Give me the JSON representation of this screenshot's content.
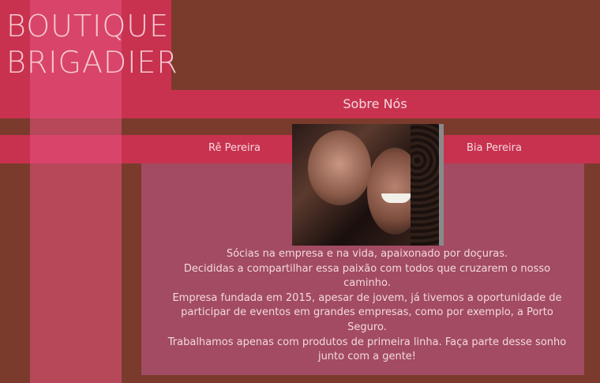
{
  "brand": {
    "line1": "BOUTIQUE",
    "line2": "BRIGADIER"
  },
  "section": {
    "title": "Sobre Nós"
  },
  "partners": {
    "left_name": "Rê Pereira",
    "right_name": "Bia Pereira"
  },
  "about": {
    "paragraph1": "Sócias na empresa e na vida, apaixonado por doçuras.",
    "paragraph2": "Decididas a compartilhar essa paixão com todos que cruzarem o nosso caminho.",
    "paragraph3": "Empresa fundada em 2015, apesar de jovem, já tivemos a oportunidade de participar de eventos em grandes empresas, como por exemplo, a Porto Seguro.",
    "paragraph4": "Trabalhamos apenas com produtos de primeira linha. Faça parte desse sonho junto com a gente!"
  },
  "colors": {
    "background": "#7a3b2c",
    "accent": "#c8324f",
    "stripe": "#e85482",
    "content_panel": "#a24b62"
  }
}
